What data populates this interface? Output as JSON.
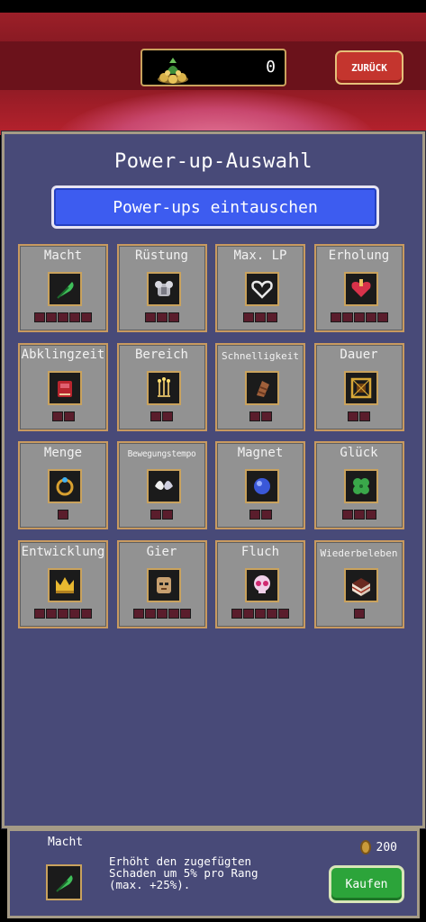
{
  "header": {
    "coin_count": "0",
    "back_label": "ZURÜCK"
  },
  "panel": {
    "title": "Power-up-Auswahl",
    "exchange_label": "Power-ups eintauschen"
  },
  "powerups": [
    {
      "name": "Macht",
      "icon": "green-feather-icon",
      "ranks": 5
    },
    {
      "name": "Rüstung",
      "icon": "armor-icon",
      "ranks": 3
    },
    {
      "name": "Max. LP",
      "icon": "heart-outline-icon",
      "ranks": 3
    },
    {
      "name": "Erholung",
      "icon": "red-heart-icon",
      "ranks": 5
    },
    {
      "name": "Abklingzeit",
      "icon": "red-tome-icon",
      "ranks": 2
    },
    {
      "name": "Bereich",
      "icon": "candelabra-icon",
      "ranks": 2
    },
    {
      "name": "Schnelligkeit",
      "icon": "bracer-icon",
      "ranks": 2
    },
    {
      "name": "Dauer",
      "icon": "golden-frame-icon",
      "ranks": 2
    },
    {
      "name": "Menge",
      "icon": "ring-icon",
      "ranks": 1
    },
    {
      "name": "Bewegungstempo",
      "icon": "wings-icon",
      "ranks": 2
    },
    {
      "name": "Magnet",
      "icon": "blue-orb-icon",
      "ranks": 2
    },
    {
      "name": "Glück",
      "icon": "clover-icon",
      "ranks": 3
    },
    {
      "name": "Entwicklung",
      "icon": "crown-icon",
      "ranks": 5
    },
    {
      "name": "Gier",
      "icon": "mask-icon",
      "ranks": 5
    },
    {
      "name": "Fluch",
      "icon": "skull-icon",
      "ranks": 5
    },
    {
      "name": "Wiederbeleben",
      "icon": "cake-icon",
      "ranks": 1
    }
  ],
  "selected": {
    "name": "Macht",
    "icon": "green-feather-icon",
    "description": "Erhöht den zugefügten\nSchaden um 5% pro Rang\n(max. +25%).",
    "price": "200",
    "buy_label": "Kaufen"
  },
  "colors": {
    "panel_bg": "#484a78",
    "card_bg": "#929292",
    "card_border": "#c89a60",
    "exchange_button": "#3d5cf0",
    "back_button": "#c4352e",
    "buy_button": "#2ca43a",
    "rank_empty": "#5a1d2c"
  }
}
